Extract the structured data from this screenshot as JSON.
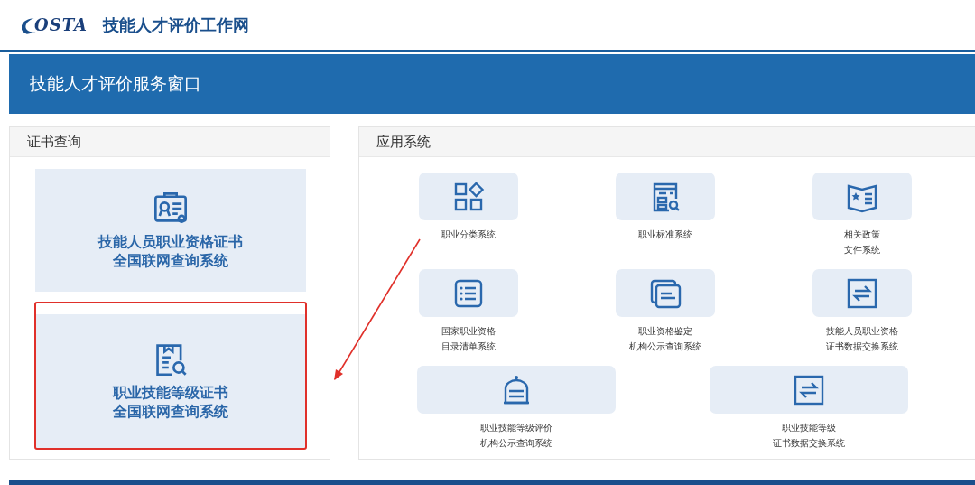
{
  "header": {
    "logo_text": "OSTA",
    "site_title": "技能人才评价工作网"
  },
  "banner": {
    "title": "技能人才评价服务窗口"
  },
  "certificate_query": {
    "title": "证书查询",
    "items": [
      {
        "kind": "certificate",
        "lines": [
          "技能人员职业资格证书",
          "全国联网查询系统"
        ],
        "highlighted": false
      },
      {
        "kind": "document-search",
        "lines": [
          "职业技能等级证书",
          "全国联网查询系统"
        ],
        "highlighted": true
      }
    ]
  },
  "applications": {
    "title": "应用系统",
    "rows": [
      [
        {
          "kind": "grid",
          "lines": [
            "职业分类系统"
          ]
        },
        {
          "kind": "form-search",
          "lines": [
            "职业标准系统"
          ]
        },
        {
          "kind": "book-star",
          "lines": [
            "相关政策",
            "文件系统"
          ]
        }
      ],
      [
        {
          "kind": "list",
          "lines": [
            "国家职业资格",
            "目录清单系统"
          ]
        },
        {
          "kind": "stack",
          "lines": [
            "职业资格鉴定",
            "机构公示查询系统"
          ]
        },
        {
          "kind": "exchange",
          "lines": [
            "技能人员职业资格",
            "证书数据交换系统"
          ]
        }
      ],
      [
        {
          "kind": "badge",
          "lines": [
            "职业技能等级评价",
            "机构公示查询系统"
          ]
        },
        {
          "kind": "exchange",
          "lines": [
            "职业技能等级",
            "证书数据交换系统"
          ]
        }
      ]
    ]
  }
}
